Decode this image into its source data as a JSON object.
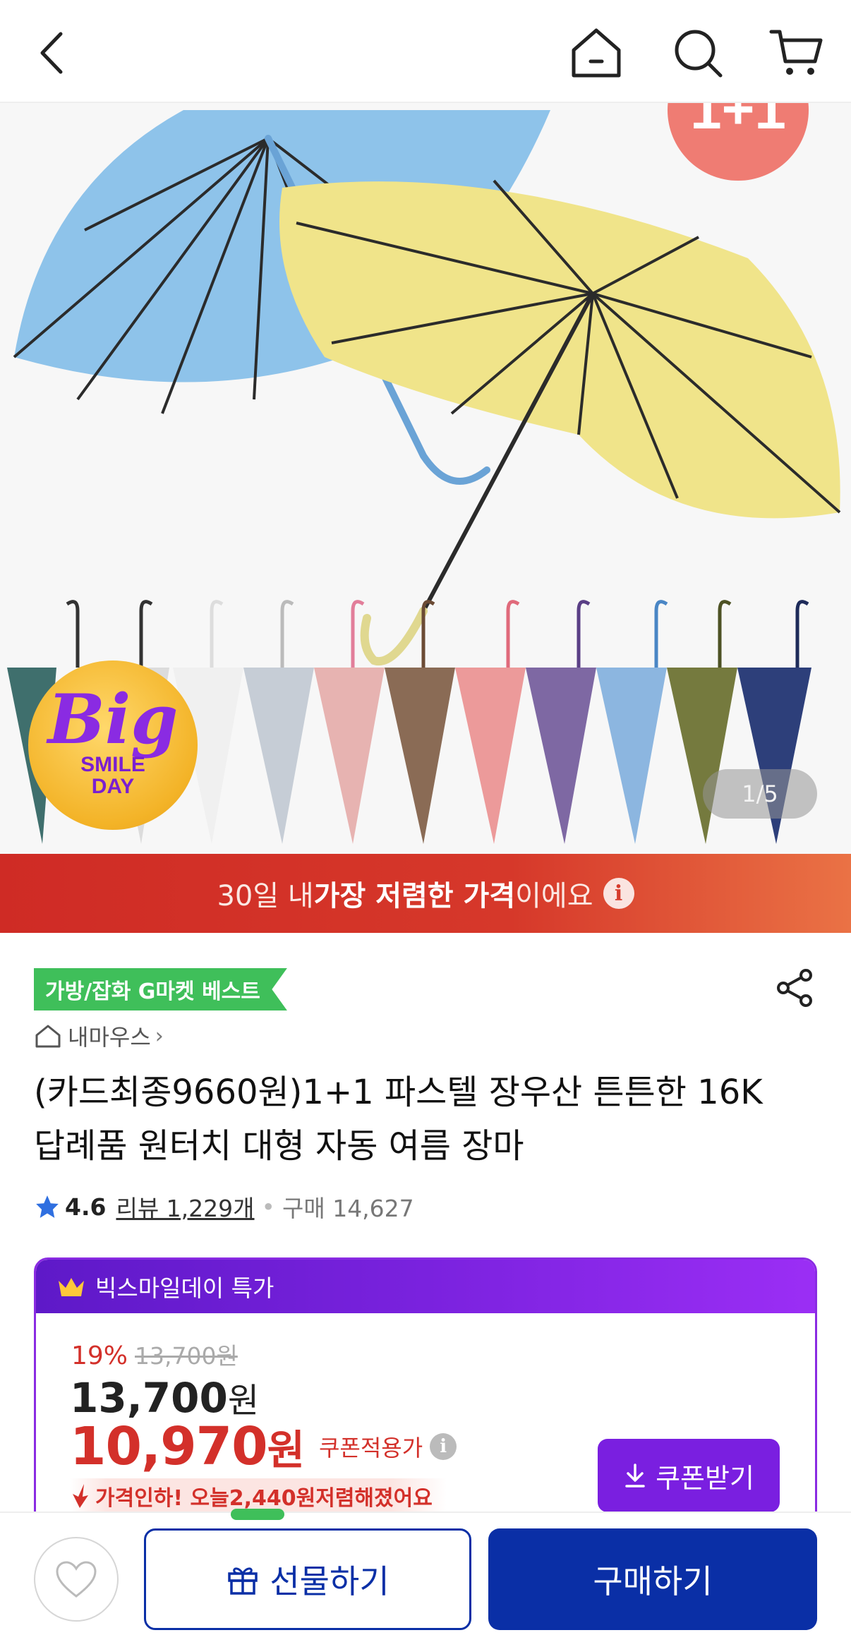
{
  "header": {
    "back_icon": "chevron-left-icon",
    "home_icon": "home-icon",
    "search_icon": "search-icon",
    "cart_icon": "cart-icon"
  },
  "hero": {
    "page_indicator": "1/5",
    "badge": {
      "big": "Big",
      "line1": "SMILE",
      "line2": "DAY"
    }
  },
  "lowest_banner": {
    "prefix": "30일 내 ",
    "bold": "가장 저렴한 가격",
    "suffix": "이에요",
    "info": "i"
  },
  "product": {
    "best_tag": "가방/잡화 G마켓 베스트",
    "store_name": "내마우스",
    "store_chevron": "›",
    "title": "(카드최종9660원)1+1 파스텔 장우산 튼튼한 16K 답례품 원터치 대형 자동 여름 장마",
    "rating": "4.6",
    "review_label": "리뷰 1,229개",
    "separator": "•",
    "purchase_label": "구매 14,627"
  },
  "deal": {
    "header": "빅스마일데이 특가",
    "discount_pct": "19%",
    "original_price": "13,700원",
    "price_amount": "13,700",
    "price_unit": "원",
    "coupon_amount": "10,970",
    "coupon_unit": "원",
    "coupon_label": "쿠폰적용가",
    "info": "i",
    "coupon_button": "쿠폰받기",
    "drop_text_prefix": "가격인하! 오늘 ",
    "drop_amount": "2,440원",
    "drop_text_suffix": " 저렴해졌어요"
  },
  "bottom": {
    "gift_label": "선물하기",
    "buy_label": "구매하기"
  },
  "colors": {
    "navy": "#0a2fa6",
    "purple": "#7a1fe0",
    "red": "#d3302a",
    "green": "#3fbf5a"
  }
}
